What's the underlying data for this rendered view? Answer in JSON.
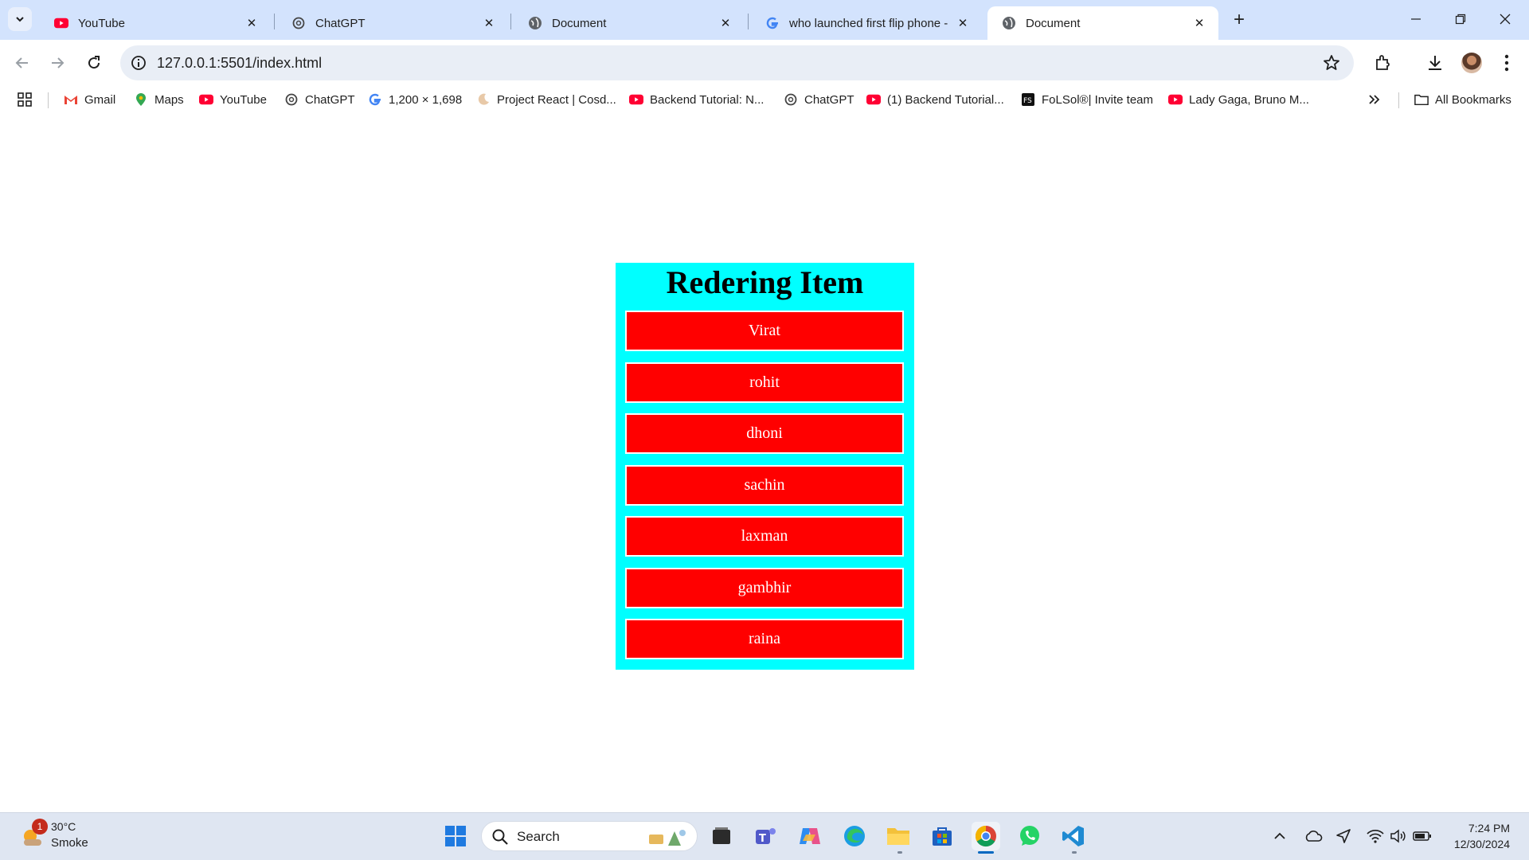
{
  "browser": {
    "tabs": [
      {
        "title": "YouTube",
        "favicon": "youtube-icon",
        "active": false
      },
      {
        "title": "ChatGPT",
        "favicon": "chatgpt-icon",
        "active": false
      },
      {
        "title": "Document",
        "favicon": "globe-icon",
        "active": false
      },
      {
        "title": "who launched first flip phone -",
        "favicon": "google-icon",
        "active": false
      },
      {
        "title": "Document",
        "favicon": "globe-icon",
        "active": true
      }
    ],
    "url": "127.0.0.1:5501/index.html",
    "bookmarks": [
      {
        "label": "Gmail",
        "icon": "gmail-icon"
      },
      {
        "label": "Maps",
        "icon": "maps-icon"
      },
      {
        "label": "YouTube",
        "icon": "youtube-icon"
      },
      {
        "label": "ChatGPT",
        "icon": "chatgpt-icon"
      },
      {
        "label": "1,200 × 1,698",
        "icon": "google-icon"
      },
      {
        "label": "Project React | Cosd...",
        "icon": "moon-icon"
      },
      {
        "label": "Backend Tutorial: N...",
        "icon": "youtube-icon"
      },
      {
        "label": "ChatGPT",
        "icon": "chatgpt-icon"
      },
      {
        "label": "(1) Backend Tutorial...",
        "icon": "youtube-icon"
      },
      {
        "label": "FoLSol®| Invite team",
        "icon": "folsol-icon"
      },
      {
        "label": "Lady Gaga, Bruno M...",
        "icon": "youtube-icon"
      }
    ],
    "all_bookmarks_label": "All Bookmarks"
  },
  "page": {
    "heading": "Redering Item",
    "items": [
      "Virat",
      "rohit",
      "dhoni",
      "sachin",
      "laxman",
      "gambhir",
      "raina"
    ],
    "panel_color": "#00ffff",
    "item_color": "#ff0000"
  },
  "taskbar": {
    "weather": {
      "badge": "1",
      "temp": "30°C",
      "condition": "Smoke"
    },
    "search_placeholder": "Search",
    "apps": [
      "windows-start-icon",
      "task-view-icon",
      "teams-icon",
      "copilot-icon",
      "edge-icon",
      "file-explorer-icon",
      "store-icon",
      "chrome-icon",
      "whatsapp-icon",
      "vscode-icon"
    ],
    "clock": {
      "time": "7:24 PM",
      "date": "12/30/2024"
    }
  }
}
